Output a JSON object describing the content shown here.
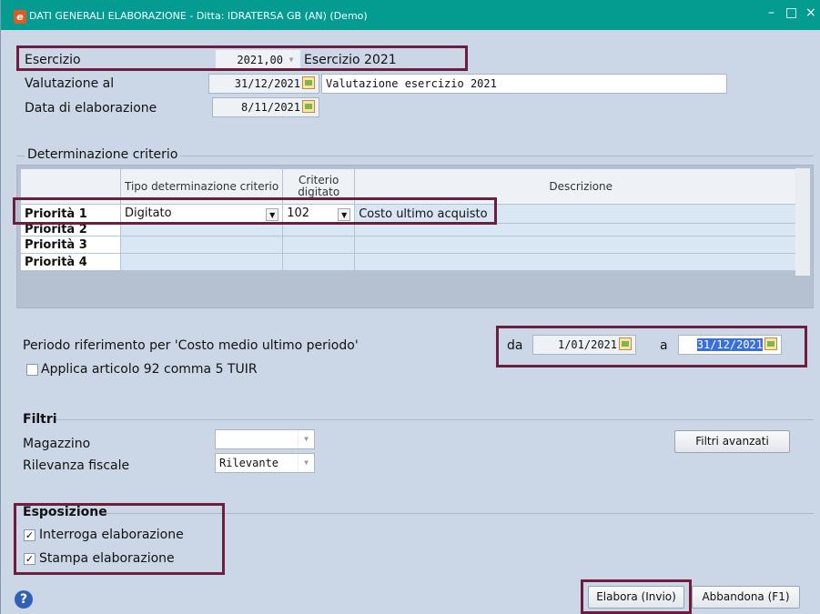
{
  "window": {
    "title": "DATI GENERALI ELABORAZIONE - Ditta: IDRATERSA GB (AN)  (Demo)",
    "logo_letter": "e",
    "minimize_glyph": "–",
    "maximize_glyph": "□",
    "close_glyph": "×"
  },
  "general": {
    "esercizio_label": "Esercizio",
    "esercizio_value": "2021,00",
    "esercizio_desc": "Esercizio 2021",
    "valutazione_label": "Valutazione al",
    "valutazione_value": "31/12/2021",
    "valutazione_desc": "Valutazione esercizio 2021",
    "data_elab_label": "Data di elaborazione",
    "data_elab_value": "8/11/2021"
  },
  "criterio": {
    "group_label": "Determinazione criterio",
    "headers": [
      "",
      "Tipo determinazione criterio",
      "Criterio digitato",
      "Descrizione"
    ],
    "rows": [
      {
        "label": "Priorità 1",
        "tipo": "Digitato",
        "criterio": "102",
        "descrizione": "Costo ultimo acquisto"
      },
      {
        "label": "Priorità 2",
        "tipo": "",
        "criterio": "",
        "descrizione": ""
      },
      {
        "label": "Priorità 3",
        "tipo": "",
        "criterio": "",
        "descrizione": ""
      },
      {
        "label": "Priorità 4",
        "tipo": "",
        "criterio": "",
        "descrizione": ""
      }
    ]
  },
  "periodo": {
    "label": "Periodo riferimento per 'Costo medio ultimo periodo'",
    "da_label": "da",
    "da_value": "1/01/2021",
    "a_label": "a",
    "a_value": "31/12/2021",
    "art92_label": "Applica articolo 92 comma 5 TUIR",
    "art92_checked": false
  },
  "filtri": {
    "group_label": "Filtri",
    "magazzino_label": "Magazzino",
    "magazzino_value": "",
    "rilevanza_label": "Rilevanza fiscale",
    "rilevanza_value": "Rilevante",
    "advanced_button": "Filtri avanzati"
  },
  "esposizione": {
    "group_label": "Esposizione",
    "interroga_label": "Interroga elaborazione",
    "interroga_checked": true,
    "stampa_label": "Stampa elaborazione",
    "stampa_checked": true
  },
  "footer": {
    "help_glyph": "?",
    "elabora_button": "Elabora (Invio)",
    "abbandona_button": "Abbandona (F1)"
  },
  "colors": {
    "titlebar": "#049b91",
    "highlight": "#6f1d3d",
    "background": "#cbd7e6"
  }
}
